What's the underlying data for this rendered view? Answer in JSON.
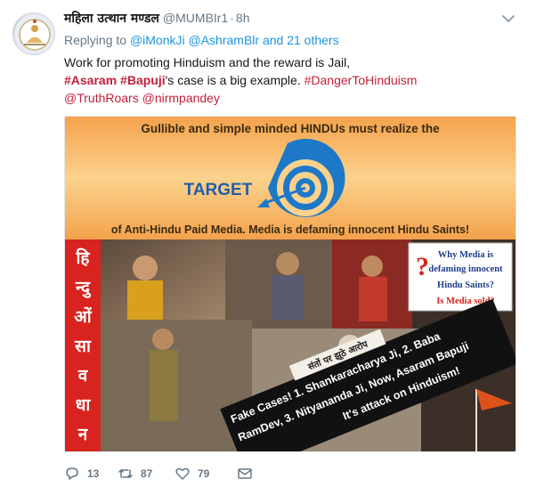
{
  "tweet": {
    "author_name": "महिला उत्थान मण्डल",
    "handle": "@MUMBIr1",
    "separator": "·",
    "time": "8h",
    "reply_prefix": "Replying to",
    "reply_mention_1": "@iMonkJi",
    "reply_mention_2": "@AshramBlr",
    "reply_suffix": "and 21 others",
    "line1": "Work for promoting Hinduism and the reward is Jail,",
    "tag_asaram": "#Asaram",
    "tag_bapuji": "#Bapuji",
    "line2_rest": "'s case is a big example.",
    "tag_danger": "#DangerToHinduism",
    "mention_truth": "@TruthRoars",
    "mention_nirm": "@nirmpandey"
  },
  "image": {
    "top_text": "Gullible and simple minded HINDUs must realize the",
    "target_label": "TARGET",
    "bottom_text": "of Anti-Hindu Paid Media. Media is defaming innocent Hindu Saints!",
    "vertical_hindi": [
      "हि",
      "न्दु",
      "ओं",
      "सा",
      "व",
      "धा",
      "न"
    ],
    "question_box": [
      "Why Media is",
      "defaming innocent",
      "Hindu Saints?",
      "Is Media sold?"
    ],
    "banner_title": "संतों पर झूठे आरोप",
    "banner_lines": [
      "Fake Cases!  1. Shankaracharya Ji,  2. Baba",
      "RamDev,  3. Nityananda Ji,   Now, Asaram Bapuji",
      "It's attack on Hinduism!"
    ]
  },
  "actions": {
    "replies": "13",
    "retweets": "87",
    "likes": "79"
  },
  "colors": {
    "link": "#1b95e0",
    "hashtag": "#c0203d",
    "muted": "#657786",
    "orange": "#f6a14a",
    "target_blue": "#1e78c8"
  },
  "icons": [
    "avatar",
    "chevron-down-icon",
    "reply-icon",
    "retweet-icon",
    "like-icon",
    "message-icon"
  ]
}
